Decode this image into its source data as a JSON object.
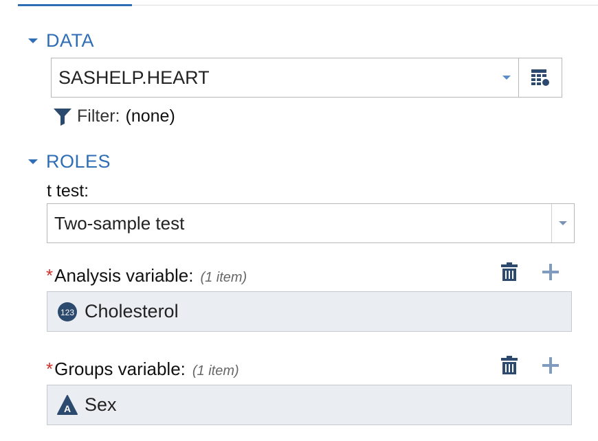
{
  "data_section": {
    "label": "DATA",
    "dataset": "SASHELP.HEART",
    "filter_label": "Filter:",
    "filter_value": "(none)"
  },
  "roles_section": {
    "label": "ROLES",
    "ttest_label": "t test:",
    "ttest_value": "Two-sample test",
    "analysis": {
      "required_mark": "*",
      "label": "Analysis variable:",
      "count": "(1 item)",
      "items": [
        {
          "name": "Cholesterol",
          "type_icon": "numeric-123-icon"
        }
      ]
    },
    "groups": {
      "required_mark": "*",
      "label": "Groups variable:",
      "count": "(1 item)",
      "items": [
        {
          "name": "Sex",
          "type_icon": "character-a-icon"
        }
      ]
    }
  },
  "colors": {
    "accent": "#2f6db5",
    "required": "#d0312d",
    "list_bg": "#eaedf2",
    "icon_dark": "#2c4a6e"
  }
}
